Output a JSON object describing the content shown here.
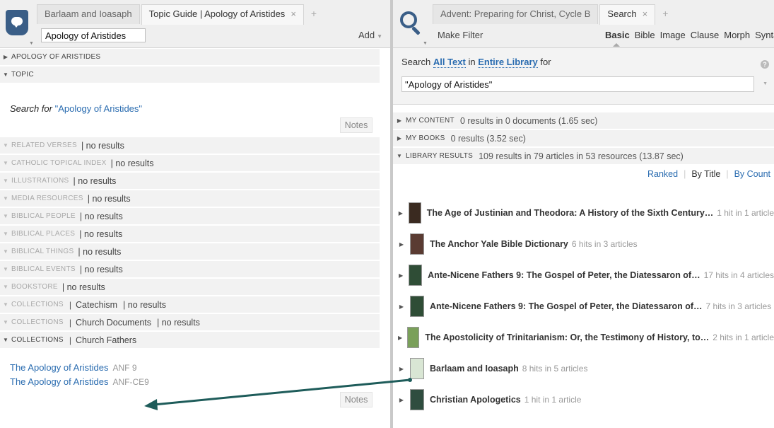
{
  "left": {
    "tabs": [
      {
        "label": "Barlaam and Ioasaph",
        "active": false
      },
      {
        "label": "Topic Guide | Apology of Aristides",
        "active": true,
        "close": "×"
      }
    ],
    "tab_add": "+",
    "topic_value": "Apology of Aristides",
    "add_label": "Add",
    "header_section": "APOLOGY OF ARISTIDES",
    "topic_section": "TOPIC",
    "search_for_prefix": "Search for",
    "search_for_link": "\"Apology of Aristides\"",
    "notes_label": "Notes",
    "sections": [
      {
        "title": "RELATED VERSES",
        "extra": "",
        "result": "| no results"
      },
      {
        "title": "CATHOLIC TOPICAL INDEX",
        "extra": "",
        "result": "| no results"
      },
      {
        "title": "ILLUSTRATIONS",
        "extra": "",
        "result": "| no results"
      },
      {
        "title": "MEDIA RESOURCES",
        "extra": "",
        "result": "| no results"
      },
      {
        "title": "BIBLICAL PEOPLE",
        "extra": "",
        "result": "| no results"
      },
      {
        "title": "BIBLICAL PLACES",
        "extra": "",
        "result": "| no results"
      },
      {
        "title": "BIBLICAL THINGS",
        "extra": "",
        "result": "| no results"
      },
      {
        "title": "BIBLICAL EVENTS",
        "extra": "",
        "result": "| no results"
      },
      {
        "title": "BOOKSTORE",
        "extra": "",
        "result": "| no results"
      },
      {
        "title": "COLLECTIONS",
        "extra": "Catechism",
        "result": "| no results"
      },
      {
        "title": "COLLECTIONS",
        "extra": "Church Documents",
        "result": "| no results"
      }
    ],
    "church_fathers": {
      "title": "COLLECTIONS",
      "extra": "Church Fathers",
      "items": [
        {
          "link": "The Apology of Aristides",
          "abbr": "ANF 9"
        },
        {
          "link": "The Apology of Aristides",
          "abbr": "ANF-CE9"
        }
      ]
    }
  },
  "right": {
    "tabs": [
      {
        "label": "Advent: Preparing for Christ, Cycle B",
        "active": false
      },
      {
        "label": "Search",
        "active": true,
        "close": "×"
      }
    ],
    "tab_add": "+",
    "make_filter": "Make Filter",
    "search_types": [
      "Basic",
      "Bible",
      "Image",
      "Clause",
      "Morph",
      "Syntax"
    ],
    "search_line": {
      "prefix": "Search",
      "scope1": "All Text",
      "mid": "in",
      "scope2": "Entire Library",
      "suffix": "for"
    },
    "help": "?",
    "query": "\"Apology of Aristides\"",
    "result_sections": [
      {
        "title": "MY CONTENT",
        "summary": "0 results in 0 documents (1.65 sec)"
      },
      {
        "title": "MY BOOKS",
        "summary": "0 results (3.52 sec)"
      },
      {
        "title": "LIBRARY RESULTS",
        "summary": "109 results in 79 articles in 53 resources (13.87 sec)"
      }
    ],
    "sort_options": [
      "Ranked",
      "By Title",
      "By Count"
    ],
    "sort_selected": 1,
    "results": [
      {
        "title": "The Age of Justinian and Theodora: A History of the Sixth Century…",
        "hits": "1 hit in 1 article",
        "cover": "#3a2a20"
      },
      {
        "title": "The Anchor Yale Bible Dictionary",
        "hits": "6 hits in 3 articles",
        "cover": "#5a3b32"
      },
      {
        "title": "Ante-Nicene Fathers 9: The Gospel of Peter, the Diatessaron of…",
        "hits": "17 hits in 4 articles",
        "cover": "#2f4d36"
      },
      {
        "title": "Ante-Nicene Fathers 9: The Gospel of Peter, the Diatessaron of…",
        "hits": "7 hits in 3 articles",
        "cover": "#2f4d36"
      },
      {
        "title": "The Apostolicity of Trinitarianism: Or, the Testimony of History, to…",
        "hits": "2 hits in 1 article",
        "cover": "#7aa05a"
      },
      {
        "title": "Barlaam and Ioasaph",
        "hits": "8 hits in 5 articles",
        "cover": "#d9e6d4"
      },
      {
        "title": "Christian Apologetics",
        "hits": "1 hit in 1 article",
        "cover": "#2f4d3f"
      }
    ]
  },
  "colors": {
    "link": "#2a6cb0",
    "logos_blue": "#3a5e87",
    "arrow": "#1e5c5a"
  }
}
